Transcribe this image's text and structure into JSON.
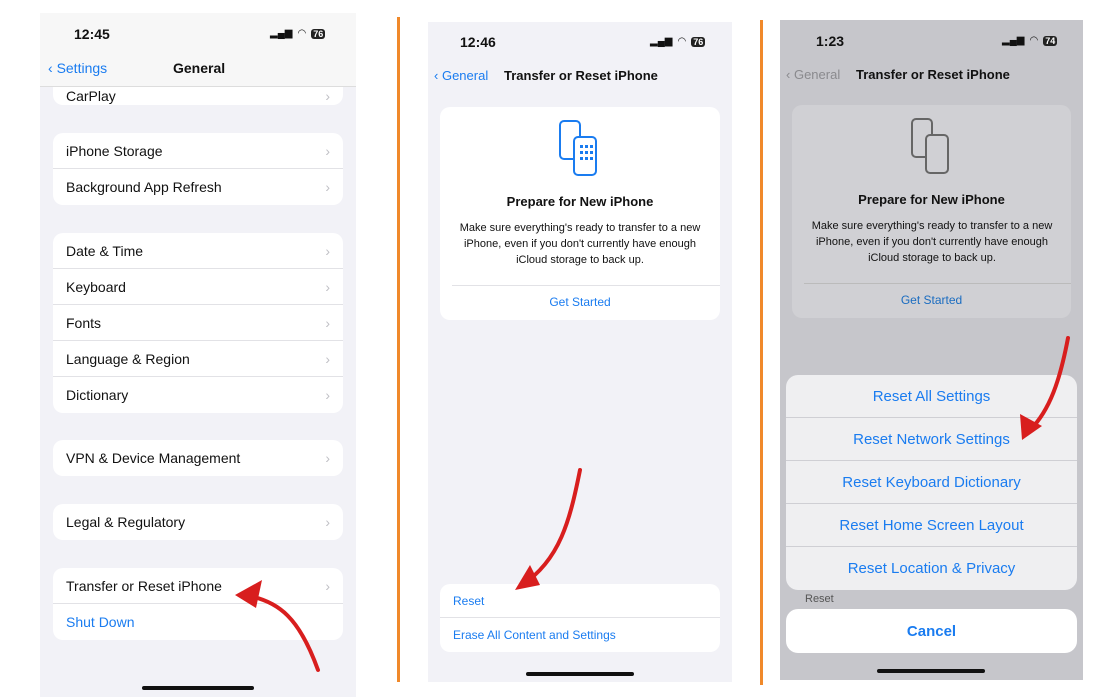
{
  "panel1": {
    "time": "12:45",
    "battery": "76",
    "back_label": "Settings",
    "title": "General",
    "partial_item": "CarPlay",
    "groups": [
      [
        "iPhone Storage",
        "Background App Refresh"
      ],
      [
        "Date & Time",
        "Keyboard",
        "Fonts",
        "Language & Region",
        "Dictionary"
      ],
      [
        "VPN & Device Management"
      ],
      [
        "Legal & Regulatory"
      ]
    ],
    "transfer": "Transfer or Reset iPhone",
    "shutdown": "Shut Down"
  },
  "panel2": {
    "time": "12:46",
    "battery": "76",
    "back_label": "General",
    "title": "Transfer or Reset iPhone",
    "card_title": "Prepare for New iPhone",
    "card_text": "Make sure everything's ready to transfer to a new iPhone, even if you don't currently have enough iCloud storage to back up.",
    "card_button": "Get Started",
    "reset": "Reset",
    "erase": "Erase All Content and Settings"
  },
  "panel3": {
    "time": "1:23",
    "battery": "74",
    "back_label": "General",
    "title": "Transfer or Reset iPhone",
    "card_title": "Prepare for New iPhone",
    "card_text": "Make sure everything's ready to transfer to a new iPhone, even if you don't currently have enough iCloud storage to back up.",
    "card_button": "Get Started",
    "behind_label": "Reset",
    "sheet_options": [
      "Reset All Settings",
      "Reset Network Settings",
      "Reset Keyboard Dictionary",
      "Reset Home Screen Layout",
      "Reset Location & Privacy"
    ],
    "cancel": "Cancel"
  },
  "colors": {
    "accent": "#1a7cf0",
    "divider": "#f0892a",
    "arrow": "#d81e1e"
  }
}
